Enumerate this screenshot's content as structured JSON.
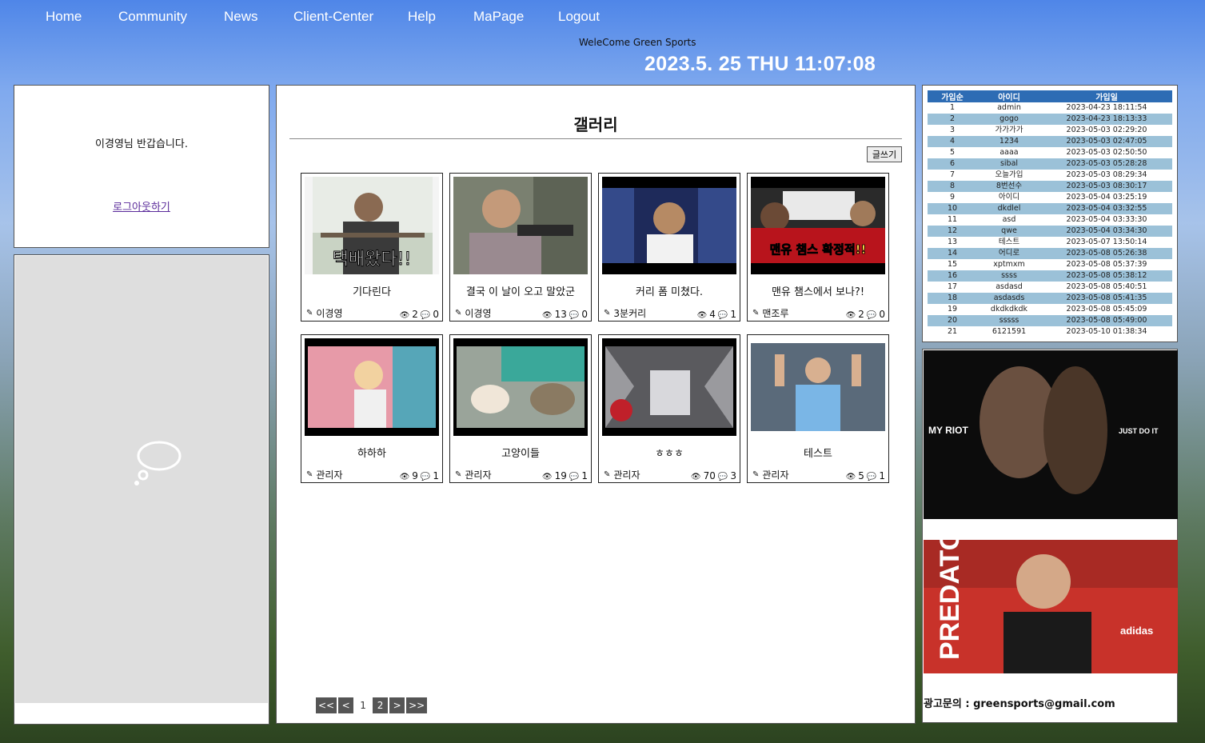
{
  "nav": [
    "Home",
    "Community",
    "News",
    "Client-Center",
    "Help",
    "MaPage",
    "Logout"
  ],
  "welcome": "WeleCome Green Sports",
  "clock": "2023.5. 25 THU 11:07:08",
  "login": {
    "message": "이경영님 반갑습니다.",
    "logout_link": "로그아웃하기"
  },
  "gallery": {
    "title": "갤러리",
    "write_button": "글쓰기",
    "posts": [
      {
        "title": "기다린다",
        "writer": "이경영",
        "views": "2",
        "comments": "0"
      },
      {
        "title": "결국 이 날이 오고 말았군",
        "writer": "이경영",
        "views": "13",
        "comments": "0"
      },
      {
        "title": "커리 폼 미쳤다.",
        "writer": "3분커리",
        "views": "4",
        "comments": "1"
      },
      {
        "title": "맨유 챔스에서 보나?!",
        "writer": "맨조루",
        "views": "2",
        "comments": "0"
      },
      {
        "title": "하하하",
        "writer": "관리자",
        "views": "9",
        "comments": "1"
      },
      {
        "title": "고양이들",
        "writer": "관리자",
        "views": "19",
        "comments": "1"
      },
      {
        "title": "ㅎㅎㅎ",
        "writer": "관리자",
        "views": "70",
        "comments": "3"
      },
      {
        "title": "테스트",
        "writer": "관리자",
        "views": "5",
        "comments": "1"
      }
    ],
    "thumb_captions": [
      "택배왔다!!",
      "",
      "",
      "맨유 챔스 확정적!!",
      "",
      "",
      "",
      ""
    ],
    "pager": {
      "first": "<<",
      "prev": "<",
      "pages": [
        "1",
        "2"
      ],
      "next": ">",
      "last": ">>"
    }
  },
  "members": {
    "headers": [
      "가입순",
      "아이디",
      "가입일"
    ],
    "rows": [
      [
        "1",
        "admin",
        "2023-04-23 18:11:54"
      ],
      [
        "2",
        "gogo",
        "2023-04-23 18:13:33"
      ],
      [
        "3",
        "가가가가",
        "2023-05-03 02:29:20"
      ],
      [
        "4",
        "1234",
        "2023-05-03 02:47:05"
      ],
      [
        "5",
        "aaaa",
        "2023-05-03 02:50:50"
      ],
      [
        "6",
        "sibal",
        "2023-05-03 05:28:28"
      ],
      [
        "7",
        "오늘가입",
        "2023-05-03 08:29:34"
      ],
      [
        "8",
        "8번선수",
        "2023-05-03 08:30:17"
      ],
      [
        "9",
        "아이디",
        "2023-05-04 03:25:19"
      ],
      [
        "10",
        "dkdlel",
        "2023-05-04 03:32:55"
      ],
      [
        "11",
        "asd",
        "2023-05-04 03:33:30"
      ],
      [
        "12",
        "qwe",
        "2023-05-04 03:34:30"
      ],
      [
        "13",
        "테스트",
        "2023-05-07 13:50:14"
      ],
      [
        "14",
        "어디로",
        "2023-05-08 05:26:38"
      ],
      [
        "15",
        "xptmxm",
        "2023-05-08 05:37:39"
      ],
      [
        "16",
        "ssss",
        "2023-05-08 05:38:12"
      ],
      [
        "17",
        "asdasd",
        "2023-05-08 05:40:51"
      ],
      [
        "18",
        "asdasds",
        "2023-05-08 05:41:35"
      ],
      [
        "19",
        "dkdkdkdk",
        "2023-05-08 05:45:09"
      ],
      [
        "20",
        "sssss",
        "2023-05-08 05:49:00"
      ],
      [
        "21",
        "6121591",
        "2023-05-10 01:38:34"
      ]
    ]
  },
  "ads": {
    "ad1_text": [
      "MY RIOT",
      "JUST DO IT"
    ],
    "ad2_text": [
      "PREDATOR",
      "adidas"
    ],
    "contact": "광고문의 : greensports@gmail.com"
  }
}
